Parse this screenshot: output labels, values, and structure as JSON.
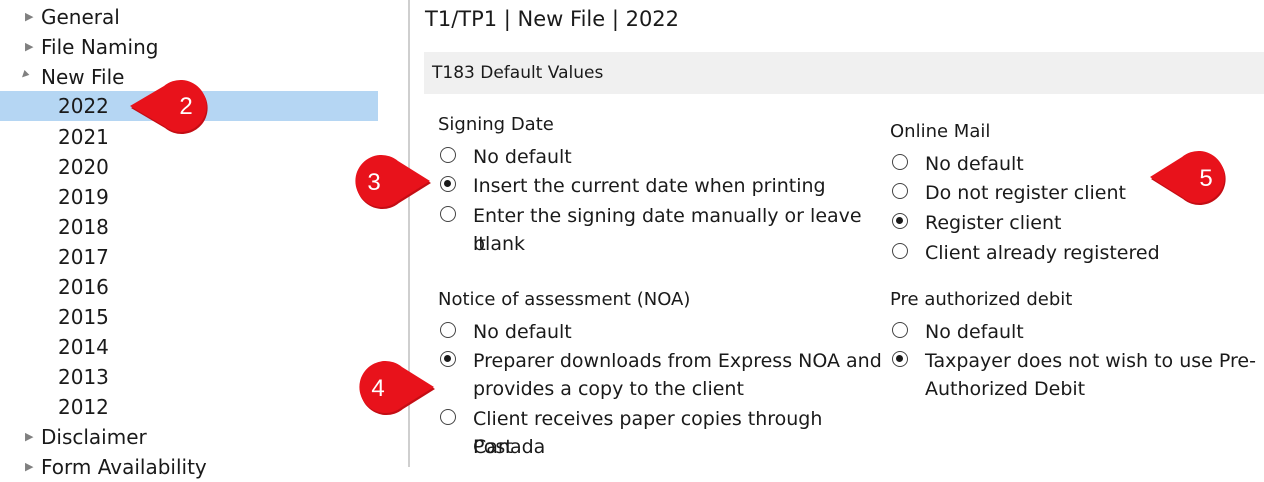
{
  "tree": {
    "items": [
      {
        "label": "General",
        "expander": "collapsed"
      },
      {
        "label": "File Naming",
        "expander": "collapsed"
      },
      {
        "label": "New File",
        "expander": "expanded"
      },
      {
        "label": "2022",
        "expander": "none"
      },
      {
        "label": "2021",
        "expander": "none"
      },
      {
        "label": "2020",
        "expander": "none"
      },
      {
        "label": "2019",
        "expander": "none"
      },
      {
        "label": "2018",
        "expander": "none"
      },
      {
        "label": "2017",
        "expander": "none"
      },
      {
        "label": "2016",
        "expander": "none"
      },
      {
        "label": "2015",
        "expander": "none"
      },
      {
        "label": "2014",
        "expander": "none"
      },
      {
        "label": "2013",
        "expander": "none"
      },
      {
        "label": "2012",
        "expander": "none"
      },
      {
        "label": "Disclaimer",
        "expander": "collapsed"
      },
      {
        "label": "Form Availability",
        "expander": "collapsed"
      }
    ],
    "selected": "2022"
  },
  "header": {
    "breadcrumb": "T1/TP1 | New File | 2022"
  },
  "section": {
    "title": "T183 Default Values"
  },
  "signing_date": {
    "label": "Signing Date",
    "options": [
      {
        "label": "No default",
        "checked": false
      },
      {
        "label": "Insert the current date when printing",
        "checked": true
      },
      {
        "label": "Enter the signing date manually or leave it",
        "checked": false,
        "cont": "blank"
      }
    ]
  },
  "noa": {
    "label": "Notice of assessment (NOA)",
    "options": [
      {
        "label": "No default",
        "checked": false
      },
      {
        "label": "Preparer downloads from Express NOA and",
        "checked": true,
        "cont": "provides a copy to the client"
      },
      {
        "label": "Client receives paper copies through Canada",
        "checked": false,
        "cont": "Post"
      }
    ]
  },
  "online_mail": {
    "label": "Online Mail",
    "options": [
      {
        "label": "No default",
        "checked": false
      },
      {
        "label": "Do not register client",
        "checked": false
      },
      {
        "label": "Register client",
        "checked": true
      },
      {
        "label": "Client already registered",
        "checked": false
      }
    ]
  },
  "pad": {
    "label": "Pre authorized debit",
    "options": [
      {
        "label": "No default",
        "checked": false
      },
      {
        "label": "Taxpayer does not wish to use Pre-",
        "checked": true,
        "cont": "Authorized Debit"
      }
    ]
  },
  "callouts": {
    "c2": "2",
    "c3": "3",
    "c4": "4",
    "c5": "5"
  },
  "colors": {
    "callout": "#e8121b",
    "selection": "#b5d6f3",
    "section_bg": "#f0f0f0"
  },
  "icons": {
    "collapsed": "expander-collapsed-icon",
    "expanded": "expander-expanded-icon"
  }
}
